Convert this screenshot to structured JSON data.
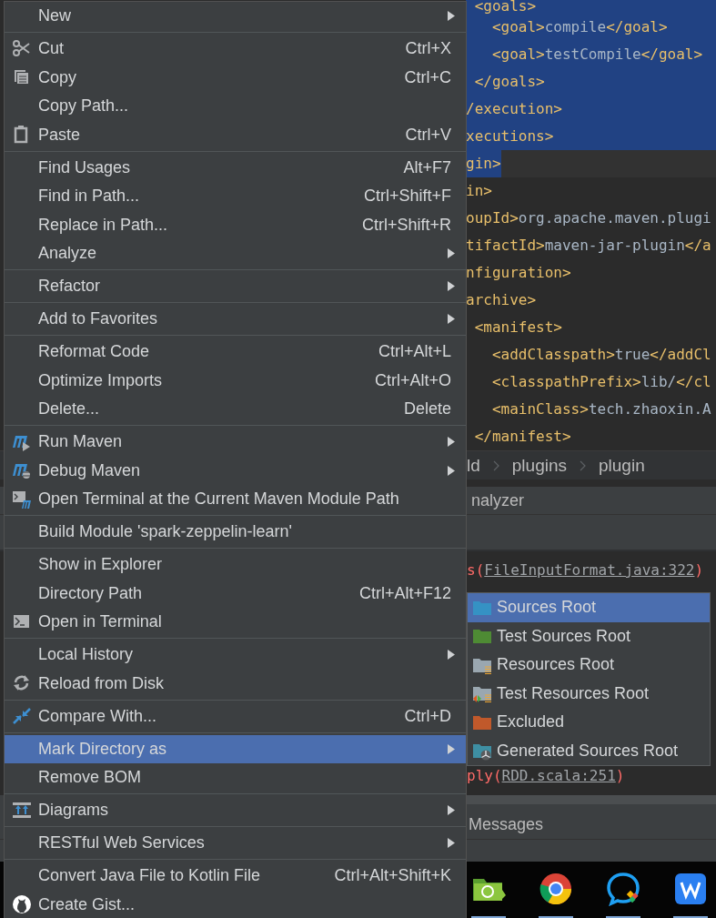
{
  "editor": {
    "lines": [
      {
        "text": " <goals>",
        "selected": true,
        "current": false
      },
      {
        "text": "   <goal>compile</goal>",
        "selected": true,
        "current": false
      },
      {
        "text": "   <goal>testCompile</goal>",
        "selected": true,
        "current": false
      },
      {
        "text": " </goals>",
        "selected": true,
        "current": false
      },
      {
        "text": "/execution>",
        "selected": true,
        "current": false
      },
      {
        "text": "xecutions>",
        "selected": true,
        "current": false
      },
      {
        "text": "gin>",
        "selected": true,
        "current": true
      },
      {
        "text": "in>",
        "selected": false
      },
      {
        "text": "oupId>org.apache.maven.plugi",
        "selected": false
      },
      {
        "text": "tifactId>maven-jar-plugin</a",
        "selected": false
      },
      {
        "text": "nfiguration>",
        "selected": false
      },
      {
        "text": "archive>",
        "selected": false
      },
      {
        "text": " <manifest>",
        "selected": false
      },
      {
        "text": "   <addClasspath>true</addCl",
        "selected": false
      },
      {
        "text": "   <classpathPrefix>lib/</cl",
        "selected": false
      },
      {
        "text": "   <mainClass>tech.zhaoxin.A",
        "selected": false
      },
      {
        "text": " </manifest>",
        "selected": false
      }
    ]
  },
  "breadcrumb": {
    "items": [
      "ld",
      "plugins",
      "plugin"
    ]
  },
  "tool_window": {
    "title": "nalyzer"
  },
  "console": {
    "lines": [
      {
        "prefix": "s(",
        "link": "FileInputFormat.java:322",
        "suffix": ")"
      }
    ],
    "last_line": {
      "prefix": "ply(",
      "link": "RDD.scala:251",
      "suffix": ")"
    }
  },
  "messages_tab": {
    "title": "Messages"
  },
  "taskbar": {
    "apps": [
      {
        "kind": "folder-sync",
        "running": true
      },
      {
        "kind": "browser",
        "running": true
      },
      {
        "kind": "chat",
        "running": true
      },
      {
        "kind": "office",
        "running": true
      }
    ]
  },
  "context_menu": {
    "sections": [
      [
        {
          "label": "New",
          "submenu": true,
          "selected": false
        }
      ],
      [
        {
          "label": "Cut",
          "kind": "scissors",
          "shortcut": "Ctrl+X",
          "selected": false
        },
        {
          "label": "Copy",
          "kind": "copy",
          "shortcut": "Ctrl+C",
          "selected": false
        },
        {
          "label": "Copy Path...",
          "selected": false
        },
        {
          "label": "Paste",
          "kind": "clipboard",
          "shortcut": "Ctrl+V",
          "selected": false
        }
      ],
      [
        {
          "label": "Find Usages",
          "shortcut": "Alt+F7",
          "selected": false
        },
        {
          "label": "Find in Path...",
          "shortcut": "Ctrl+Shift+F",
          "selected": false
        },
        {
          "label": "Replace in Path...",
          "shortcut": "Ctrl+Shift+R",
          "selected": false
        },
        {
          "label": "Analyze",
          "submenu": true,
          "selected": false
        }
      ],
      [
        {
          "label": "Refactor",
          "submenu": true,
          "selected": false
        }
      ],
      [
        {
          "label": "Add to Favorites",
          "submenu": true,
          "selected": false
        }
      ],
      [
        {
          "label": "Reformat Code",
          "shortcut": "Ctrl+Alt+L",
          "selected": false
        },
        {
          "label": "Optimize Imports",
          "shortcut": "Ctrl+Alt+O",
          "selected": false
        },
        {
          "label": "Delete...",
          "shortcut": "Delete",
          "selected": false
        }
      ],
      [
        {
          "label": "Run Maven",
          "kind": "maven-run",
          "submenu": true,
          "selected": false
        },
        {
          "label": "Debug Maven",
          "kind": "maven-debug",
          "submenu": true,
          "selected": false
        },
        {
          "label": "Open Terminal at the Current Maven Module Path",
          "kind": "terminal-maven",
          "selected": false
        }
      ],
      [
        {
          "label": "Build Module 'spark-zeppelin-learn'",
          "selected": false
        }
      ],
      [
        {
          "label": "Show in Explorer",
          "selected": false
        },
        {
          "label": "Directory Path",
          "shortcut": "Ctrl+Alt+F12",
          "selected": false
        },
        {
          "label": "Open in Terminal",
          "kind": "terminal",
          "selected": false
        }
      ],
      [
        {
          "label": "Local History",
          "submenu": true,
          "selected": false
        },
        {
          "label": "Reload from Disk",
          "kind": "reload",
          "selected": false
        }
      ],
      [
        {
          "label": "Compare With...",
          "kind": "compare",
          "shortcut": "Ctrl+D",
          "selected": false
        }
      ],
      [
        {
          "label": "Mark Directory as",
          "submenu": true,
          "selected": true
        },
        {
          "label": "Remove BOM",
          "selected": false
        }
      ],
      [
        {
          "label": "Diagrams",
          "kind": "diagram",
          "submenu": true,
          "selected": false
        }
      ],
      [
        {
          "label": "RESTful Web Services",
          "submenu": true,
          "selected": false
        }
      ],
      [
        {
          "label": "Convert Java File to Kotlin File",
          "shortcut": "Ctrl+Alt+Shift+K",
          "selected": false
        },
        {
          "label": "Create Gist...",
          "kind": "cat",
          "selected": false
        }
      ]
    ]
  },
  "submenu": {
    "items": [
      {
        "label": "Sources Root",
        "kind": "sources",
        "selected": true
      },
      {
        "label": "Test Sources Root",
        "kind": "test-sources",
        "selected": false
      },
      {
        "label": "Resources Root",
        "kind": "resources",
        "selected": false
      },
      {
        "label": "Test Resources Root",
        "kind": "test-resources",
        "selected": false
      },
      {
        "label": "Excluded",
        "kind": "excluded",
        "selected": false
      },
      {
        "label": "Generated Sources Root",
        "kind": "generated",
        "selected": false
      }
    ]
  }
}
